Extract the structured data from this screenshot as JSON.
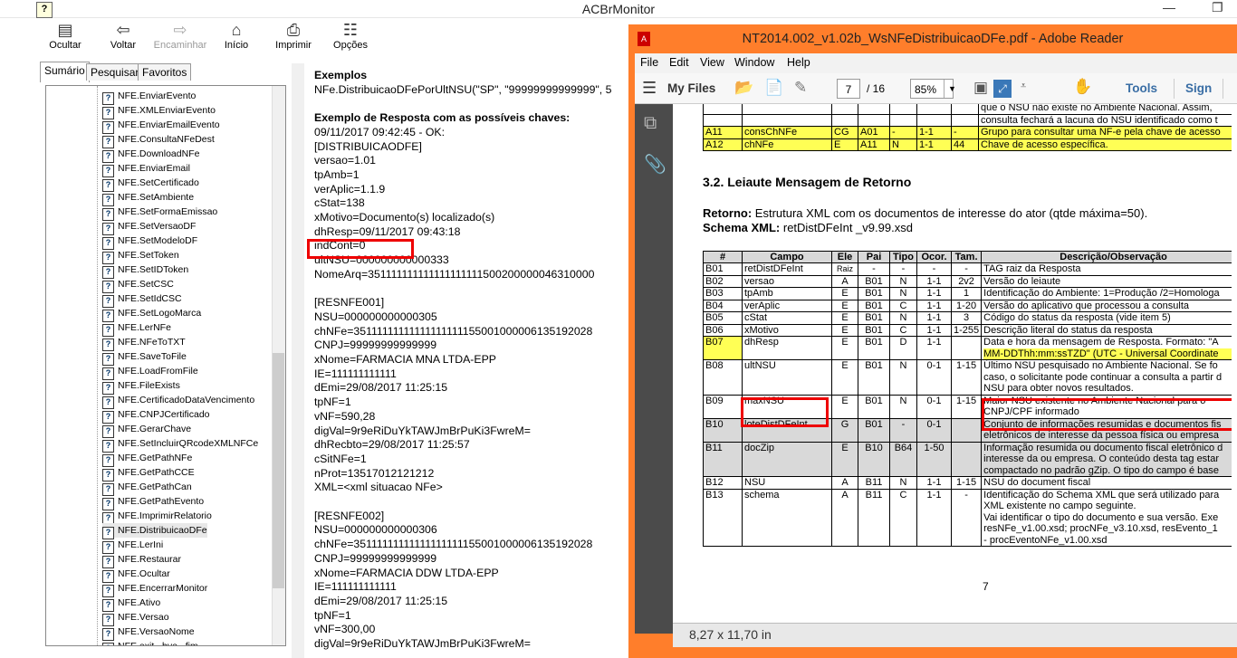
{
  "help_window": {
    "title": "ACBrMonitor",
    "toolbar": [
      {
        "icon": "hide-icon",
        "label": "Ocultar",
        "enabled": true
      },
      {
        "icon": "back-arrow-icon",
        "label": "Voltar",
        "enabled": true
      },
      {
        "icon": "forward-arrow-icon",
        "label": "Encaminhar",
        "enabled": false
      },
      {
        "icon": "home-icon",
        "label": "Início",
        "enabled": true
      },
      {
        "icon": "printer-icon",
        "label": "Imprimir",
        "enabled": true
      },
      {
        "icon": "options-icon",
        "label": "Opções",
        "enabled": true
      }
    ],
    "tabs": [
      "Sumário",
      "Pesquisar",
      "Favoritos"
    ],
    "tree_items": [
      "NFE.EnviarEvento",
      "NFE.XMLEnviarEvento",
      "NFE.EnviarEmailEvento",
      "NFE.ConsultaNFeDest",
      "NFE.DownloadNFe",
      "NFE.EnviarEmail",
      "NFE.SetCertificado",
      "NFE.SetAmbiente",
      "NFE.SetFormaEmissao",
      "NFE.SetVersaoDF",
      "NFE.SetModeloDF",
      "NFE.SetToken",
      "NFE.SetIDToken",
      "NFE.SetCSC",
      "NFE.SetIdCSC",
      "NFE.SetLogoMarca",
      "NFE.LerNFe",
      "NFE.NFeToTXT",
      "NFE.SaveToFile",
      "NFE.LoadFromFile",
      "NFE.FileExists",
      "NFE.CertificadoDataVencimento",
      "NFE.CNPJCertificado",
      "NFE.GerarChave",
      "NFE.SetIncluirQRcodeXMLNFCe",
      "NFE.GetPathNFe",
      "NFE.GetPathCCE",
      "NFE.GetPathCan",
      "NFE.GetPathEvento",
      "NFE.ImprimirRelatorio",
      "NFE.DistribuicaoDFe",
      "NFE.LerIni",
      "NFE.Restaurar",
      "NFE.Ocultar",
      "NFE.EncerrarMonitor",
      "NFE.Ativo",
      "NFE.Versao",
      "NFE.VersaoNome",
      "NFE.exit , bye , fim"
    ],
    "selected_item": "NFE.DistribuicaoDFe",
    "content_lines": [
      {
        "t": "Exemplos",
        "b": true
      },
      {
        "t": "NFe.DistribuicaoDFePorUltNSU(\"SP\", \"99999999999999\", 5",
        "b": false
      },
      {
        "t": "",
        "b": false
      },
      {
        "t": "Exemplo de Resposta com as possíveis chaves:",
        "b": true
      },
      {
        "t": "09/11/2017 09:42:45 - OK:",
        "b": false
      },
      {
        "t": "[DISTRIBUICAODFE]",
        "b": false
      },
      {
        "t": "versao=1.01",
        "b": false
      },
      {
        "t": "tpAmb=1",
        "b": false
      },
      {
        "t": "verAplic=1.1.9",
        "b": false
      },
      {
        "t": "cStat=138",
        "b": false
      },
      {
        "t": "xMotivo=Documento(s) localizado(s)",
        "b": false
      },
      {
        "t": "dhResp=09/11/2017 09:43:18",
        "b": false
      },
      {
        "t": "indCont=0",
        "b": false
      },
      {
        "t": "ultNSU=000000000000333",
        "b": false
      },
      {
        "t": "NomeArq=351111111111111111111500200000046310000",
        "b": false
      },
      {
        "t": "",
        "b": false
      },
      {
        "t": "[RESNFE001]",
        "b": false
      },
      {
        "t": "NSU=000000000000305",
        "b": false
      },
      {
        "t": "chNFe=35111111111111111111155001000006135192028",
        "b": false
      },
      {
        "t": "CNPJ=99999999999999",
        "b": false
      },
      {
        "t": "xNome=FARMACIA MNA LTDA-EPP",
        "b": false
      },
      {
        "t": "IE=111111111111",
        "b": false
      },
      {
        "t": "dEmi=29/08/2017 11:25:15",
        "b": false
      },
      {
        "t": "tpNF=1",
        "b": false
      },
      {
        "t": "vNF=590,28",
        "b": false
      },
      {
        "t": "digVal=9r9eRiDuYkTAWJmBrPuKi3FwreM=",
        "b": false
      },
      {
        "t": "dhRecbto=29/08/2017 11:25:57",
        "b": false
      },
      {
        "t": "cSitNFe=1",
        "b": false
      },
      {
        "t": "nProt=13517012121212",
        "b": false
      },
      {
        "t": "XML=<xml situacao NFe>",
        "b": false
      },
      {
        "t": "",
        "b": false
      },
      {
        "t": "[RESNFE002]",
        "b": false
      },
      {
        "t": "NSU=000000000000306",
        "b": false
      },
      {
        "t": "chNFe=35111111111111111111155001000006135192028",
        "b": false
      },
      {
        "t": "CNPJ=99999999999999",
        "b": false
      },
      {
        "t": "xNome=FARMACIA DDW LTDA-EPP",
        "b": false
      },
      {
        "t": "IE=111111111111",
        "b": false
      },
      {
        "t": "dEmi=29/08/2017 11:25:15",
        "b": false
      },
      {
        "t": "tpNF=1",
        "b": false
      },
      {
        "t": "vNF=300,00",
        "b": false
      },
      {
        "t": "digVal=9r9eRiDuYkTAWJmBrPuKi3FwreM=",
        "b": false
      }
    ]
  },
  "pdf_window": {
    "title": "NT2014.002_v1.02b_WsNFeDistribuicaoDFe.pdf - Adobe Reader",
    "menu": [
      "File",
      "Edit",
      "View",
      "Window",
      "Help"
    ],
    "toolbar": {
      "my_files": "My Files",
      "page": "7",
      "page_total": "/ 16",
      "zoom": "85%",
      "tools": "Tools",
      "sign": "Sign"
    },
    "status": "8,27 x 11,70 in",
    "top_rows": [
      {
        "id": "",
        "campo": "",
        "ele": "",
        "pai": "",
        "tipo": "",
        "ocor": "",
        "tam": "",
        "desc": "que o NSU não existe no Ambiente Nacional. Assim, ",
        "hl": false
      },
      {
        "id": "",
        "campo": "",
        "ele": "",
        "pai": "",
        "tipo": "",
        "ocor": "",
        "tam": "",
        "desc": "consulta fechará a lacuna do NSU identificado como t",
        "hl": false
      },
      {
        "id": "A11",
        "campo": "consChNFe",
        "ele": "CG",
        "pai": "A01",
        "tipo": "-",
        "ocor": "1-1",
        "tam": "-",
        "desc": "Grupo para consultar uma NF-e pela chave de acesso",
        "hl": true
      },
      {
        "id": "A12",
        "campo": "chNFe",
        "ele": "E",
        "pai": "A11",
        "tipo": "N",
        "ocor": "1-1",
        "tam": "44",
        "desc": "Chave de acesso específica.",
        "hl": true
      }
    ],
    "section_heading": "3.2.  Leiaute Mensagem de Retorno",
    "retorno_label": "Retorno:",
    "retorno_text": " Estrutura XML com os documentos de interesse do ator (qtde máxima=50).",
    "schema_label": "Schema XML:",
    "schema_text": " retDistDFeInt _v9.99.xsd",
    "table_headers": [
      "#",
      "Campo",
      "Ele",
      "Pai",
      "Tipo",
      "Ocor.",
      "Tam.",
      "Descrição/Observação"
    ],
    "rows": [
      {
        "id": "B01",
        "campo": "retDistDFeInt",
        "ele": "Raiz",
        "pai": "-",
        "tipo": "-",
        "ocor": "-",
        "tam": "-",
        "desc": [
          "TAG raiz da Resposta"
        ],
        "gray": false
      },
      {
        "id": "B02",
        "campo": "versao",
        "ele": "A",
        "pai": "B01",
        "tipo": "N",
        "ocor": "1-1",
        "tam": "2v2",
        "desc": [
          "Versão do leiaute"
        ],
        "gray": false
      },
      {
        "id": "B03",
        "campo": "tpAmb",
        "ele": "E",
        "pai": "B01",
        "tipo": "N",
        "ocor": "1-1",
        "tam": "1",
        "desc": [
          "Identificação do Ambiente: 1=Produção /2=Homologa"
        ],
        "gray": false
      },
      {
        "id": "B04",
        "campo": "verAplic",
        "ele": "E",
        "pai": "B01",
        "tipo": "C",
        "ocor": "1-1",
        "tam": "1-20",
        "desc": [
          "Versão do aplicativo que processou a consulta"
        ],
        "gray": false
      },
      {
        "id": "B05",
        "campo": "cStat",
        "ele": "E",
        "pai": "B01",
        "tipo": "N",
        "ocor": "1-1",
        "tam": "3",
        "desc": [
          "Código do status da resposta (vide item 5)"
        ],
        "gray": false
      },
      {
        "id": "B06",
        "campo": "xMotivo",
        "ele": "E",
        "pai": "B01",
        "tipo": "C",
        "ocor": "1-1",
        "tam": "1-255",
        "desc": [
          "Descrição literal do status da resposta"
        ],
        "gray": false
      },
      {
        "id": "B07",
        "campo": "dhResp",
        "ele": "E",
        "pai": "B01",
        "tipo": "D",
        "ocor": "1-1",
        "tam": "",
        "desc": [
          "Data e hora da mensagem de Resposta. Formato: \"A",
          "MM-DDThh:mm:ssTZD\" (UTC - Universal Coordinate"
        ],
        "gray": false,
        "hl_id": true
      },
      {
        "id": "B08",
        "campo": "ultNSU",
        "ele": "E",
        "pai": "B01",
        "tipo": "N",
        "ocor": "0-1",
        "tam": "1-15",
        "desc": [
          "Último NSU pesquisado no Ambiente Nacional. Se fo",
          "caso, o solicitante pode continuar a consulta a partir d",
          "NSU para obter novos resultados."
        ],
        "gray": false
      },
      {
        "id": "B09",
        "campo": "maxNSU",
        "ele": "E",
        "pai": "B01",
        "tipo": "N",
        "ocor": "0-1",
        "tam": "1-15",
        "desc": [
          "Maior NSU existente no Ambiente Nacional para o",
          "CNPJ/CPF informado"
        ],
        "gray": false
      },
      {
        "id": "B10",
        "campo": "loteDistDFeInt",
        "ele": "G",
        "pai": "B01",
        "tipo": "-",
        "ocor": "0-1",
        "tam": "",
        "desc": [
          "Conjunto de informações resumidas e documentos fis",
          "eletrônicos de interesse da pessoa física ou empresa"
        ],
        "gray": true
      },
      {
        "id": "B11",
        "campo": "docZip",
        "ele": "E",
        "pai": "B10",
        "tipo": "B64",
        "ocor": "1-50",
        "tam": "",
        "desc": [
          "Informação resumida ou documento fiscal eletrônico d",
          "interesse da ou empresa. O conteúdo desta tag estar",
          "compactado no padrão gZip. O tipo do campo é base"
        ],
        "gray": true
      },
      {
        "id": "B12",
        "campo": "NSU",
        "ele": "A",
        "pai": "B11",
        "tipo": "N",
        "ocor": "1-1",
        "tam": "1-15",
        "desc": [
          "NSU do document fiscal"
        ],
        "gray": false
      },
      {
        "id": "B13",
        "campo": "schema",
        "ele": "A",
        "pai": "B11",
        "tipo": "C",
        "ocor": "1-1",
        "tam": "-",
        "desc": [
          "Identificação do Schema XML que será utilizado para",
          "XML existente no campo seguinte.",
          "Vai identificar o tipo do documento e sua versão. Exe",
          "resNFe_v1.00.xsd; procNFe_v3.10.xsd, resEvento_1",
          "- procEventoNFe_v1.00.xsd"
        ],
        "gray": false
      }
    ],
    "page_number": "7"
  }
}
